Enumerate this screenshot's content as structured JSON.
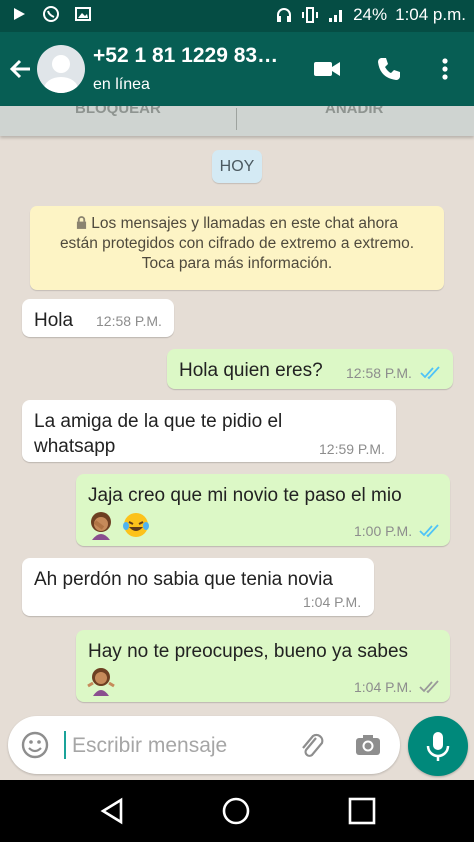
{
  "status_bar": {
    "battery": "24%",
    "time": "1:04 p.m.",
    "left_icons": [
      "play-icon",
      "whatsapp-icon",
      "image-icon"
    ],
    "right_icons": [
      "headset-icon",
      "vibrate-icon",
      "signal-icon"
    ]
  },
  "header": {
    "contact_name": "+52 1 81 1229 83…",
    "status": "en línea",
    "icons": [
      "back-arrow-icon",
      "avatar-icon",
      "video-call-icon",
      "phone-call-icon",
      "more-options-icon"
    ]
  },
  "banner": {
    "block_label": "BLOQUEAR",
    "add_label": "AÑADIR"
  },
  "chat": {
    "day_label": "HOY",
    "encryption_notice": [
      "Los mensajes y llamadas en este chat ahora",
      "están protegidos con cifrado de extremo a extremo.",
      "Toca para más información."
    ],
    "messages": [
      {
        "direction": "in",
        "lines": [
          "Hola"
        ],
        "time": "12:58 P.M."
      },
      {
        "direction": "out",
        "lines": [
          "Hola quien eres?"
        ],
        "time": "12:58 P.M.",
        "status": "read"
      },
      {
        "direction": "in",
        "lines": [
          "La amiga de la que te pidio el",
          "whatsapp"
        ],
        "time": "12:59 P.M."
      },
      {
        "direction": "out",
        "lines": [
          "Jaja creo que mi novio te paso el mio"
        ],
        "emojis": [
          "woman-facepalming-emoji",
          "laughing-tears-emoji"
        ],
        "time": "1:00 P.M.",
        "status": "read"
      },
      {
        "direction": "in",
        "lines": [
          "Ah perdón no sabia que tenia novia"
        ],
        "time": "1:04 P.M."
      },
      {
        "direction": "out",
        "lines": [
          "Hay no te preocupes, bueno ya sabes"
        ],
        "emojis": [
          "woman-shrugging-emoji"
        ],
        "time": "1:04 P.M.",
        "status": "delivered"
      }
    ]
  },
  "composer": {
    "placeholder": "Escribir mensaje",
    "icons": [
      "emoji-icon",
      "attach-icon",
      "camera-icon",
      "microphone-icon"
    ]
  },
  "colors": {
    "header": "#075e54",
    "status_bar": "#054d44",
    "outgoing_bubble": "#dcf8c6",
    "incoming_bubble": "#ffffff",
    "read_ticks": "#4fc3f7",
    "notice_bg": "#fdf4c5",
    "mic_button": "#00897b"
  },
  "nav_bar": {
    "icons": [
      "back-triangle-icon",
      "home-circle-icon",
      "recents-square-icon"
    ]
  }
}
